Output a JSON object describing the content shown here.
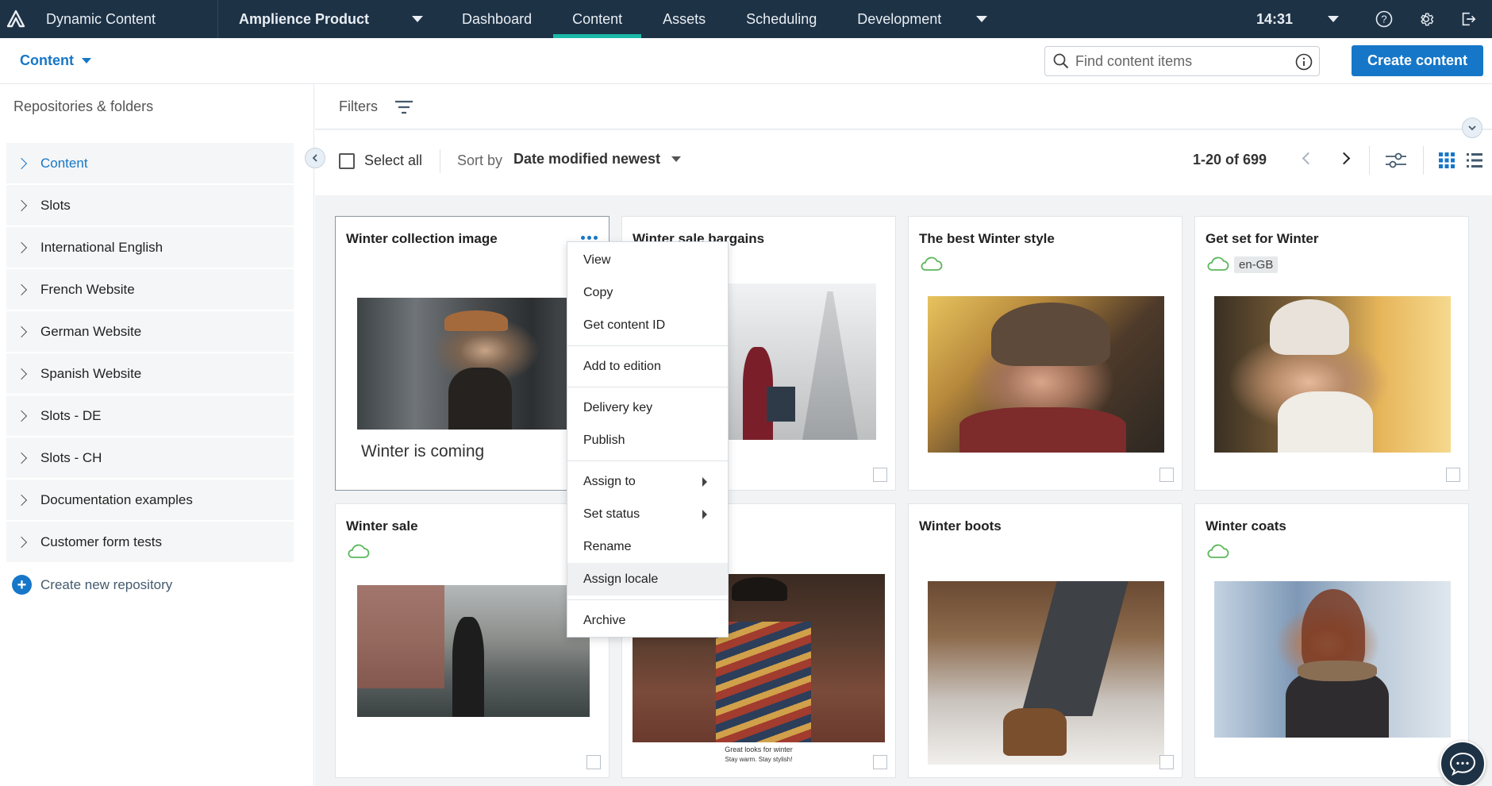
{
  "topbar": {
    "app_name": "Dynamic Content",
    "hub_name": "Amplience Product",
    "nav": [
      "Dashboard",
      "Content",
      "Assets",
      "Scheduling",
      "Development"
    ],
    "active_nav": "Content",
    "time": "14:31"
  },
  "subheader": {
    "content_dropdown": "Content",
    "search_placeholder": "Find content items",
    "create_button": "Create content"
  },
  "sidebar": {
    "title": "Repositories & folders",
    "items": [
      "Content",
      "Slots",
      "International English",
      "French Website",
      "German Website",
      "Spanish Website",
      "Slots - DE",
      "Slots - CH",
      "Documentation examples",
      "Customer form tests"
    ],
    "selected": "Content",
    "create_repo": "Create new repository"
  },
  "main": {
    "filters_label": "Filters",
    "select_all": "Select all",
    "sort_by_label": "Sort by",
    "sort_value": "Date modified newest",
    "paging": "1-20 of 699"
  },
  "cards": [
    {
      "title": "Winter collection image",
      "subtitle": "Winter is coming"
    },
    {
      "title": "Winter sale bargains"
    },
    {
      "title": "The best Winter style"
    },
    {
      "title": "Get set for Winter",
      "locale": "en-GB"
    },
    {
      "title": "Winter sale"
    },
    {
      "title": "",
      "caption_main": "Great looks for winter",
      "caption_sub": "Stay warm. Stay stylish!"
    },
    {
      "title": "Winter boots"
    },
    {
      "title": "Winter coats"
    }
  ],
  "context_menu": {
    "group1": [
      "View",
      "Copy",
      "Get content ID"
    ],
    "group2": [
      "Add to edition"
    ],
    "group3": [
      "Delivery key",
      "Publish"
    ],
    "group4": [
      "Assign to",
      "Set status",
      "Rename",
      "Assign locale"
    ],
    "group5": [
      "Archive"
    ],
    "hovered": "Assign locale"
  },
  "colors": {
    "topbar_bg": "#1e3246",
    "accent_blue": "#1677c8",
    "active_tab": "#1bb9a8",
    "published_green": "#5cb85c"
  }
}
